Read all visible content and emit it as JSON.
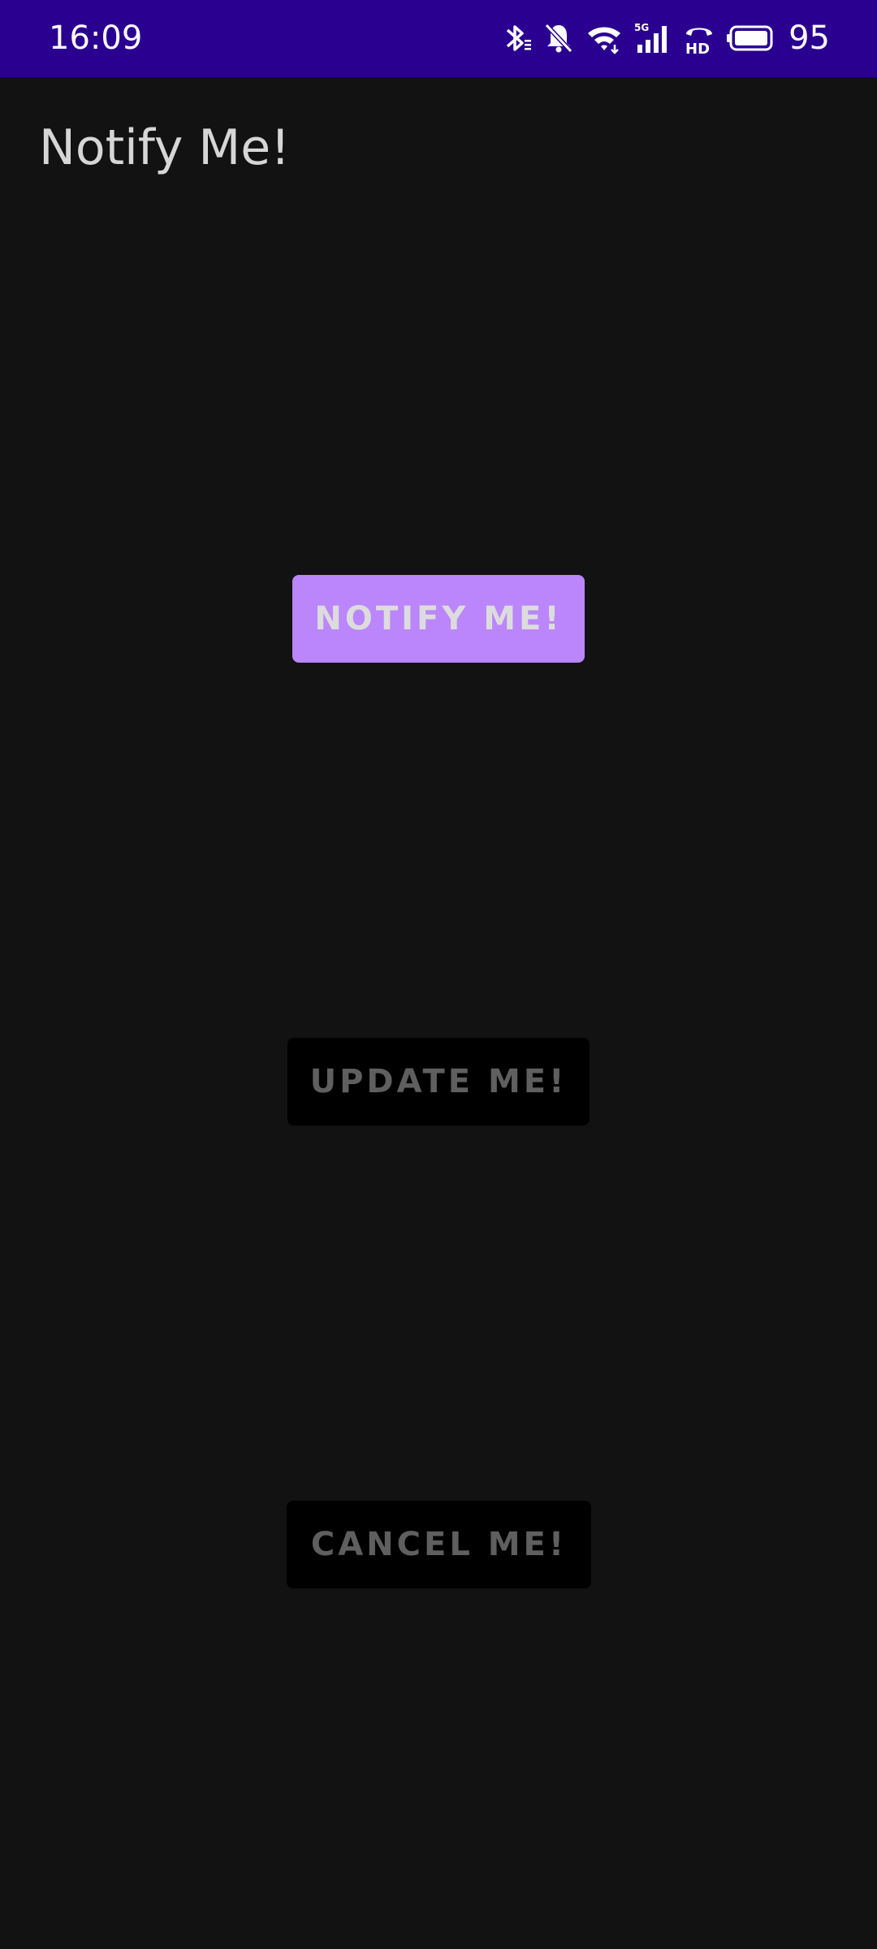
{
  "status_bar": {
    "time": "16:09",
    "battery_level": "95",
    "icons": [
      "bluetooth-icon",
      "bell-off-icon",
      "wifi-icon",
      "signal-5g-icon",
      "hd-call-icon",
      "battery-icon"
    ],
    "background_color": "#2a0090"
  },
  "app_bar": {
    "title": "Notify Me!"
  },
  "buttons": {
    "notify_label": "NOTIFY ME!",
    "update_label": "UPDATE ME!",
    "cancel_label": "CANCEL ME!"
  },
  "colors": {
    "background": "#121212",
    "accent": "#bb86fc",
    "disabled_button": "#000000",
    "disabled_text": "#5f5f5f"
  }
}
